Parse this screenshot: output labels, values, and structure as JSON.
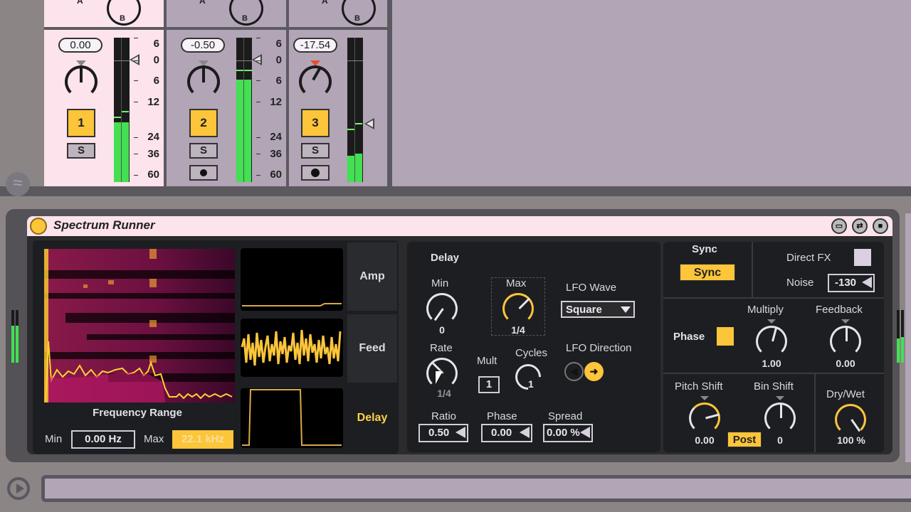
{
  "colors": {
    "accent": "#fcc53a",
    "meter_green": "#42e052",
    "title_bar": "#fde3ec",
    "device_bg": "#1d1e21",
    "mixer_bg": "#b2a5b6"
  },
  "mixer": {
    "crossfader": {
      "a_label": "A",
      "b_label": "B"
    },
    "meter_scale": [
      "6",
      "0",
      "6",
      "12",
      "24",
      "36",
      "60"
    ],
    "tracks": [
      {
        "number": "1",
        "volume": "0.00",
        "solo_label": "S",
        "arm_icon": "",
        "selected": true,
        "meter_level_left": 0.4,
        "meter_level_right": 0.42
      },
      {
        "number": "2",
        "volume": "-0.50",
        "solo_label": "S",
        "arm_icon": "metronome-icon",
        "selected": false,
        "meter_level_right": 0.71
      },
      {
        "number": "3",
        "volume": "-17.54",
        "solo_label": "S",
        "arm_icon": "record-icon",
        "selected": false,
        "meter_level_left": 0.18,
        "meter_level_right": 0.19
      }
    ]
  },
  "device": {
    "title": "Spectrum Runner",
    "title_icons": [
      "hot-swap-icon",
      "map-icon",
      "save-preset-icon"
    ],
    "frequency_range": {
      "label": "Frequency Range",
      "min_label": "Min",
      "min_value": "0.00 Hz",
      "max_label": "Max",
      "max_value": "22.1 kHz"
    },
    "tabs": [
      {
        "label": "Amp",
        "active": false
      },
      {
        "label": "Feed",
        "active": false
      },
      {
        "label": "Delay",
        "active": true
      }
    ],
    "delay": {
      "section_title": "Delay",
      "min": {
        "label": "Min",
        "value": "0"
      },
      "max": {
        "label": "Max",
        "value": "1/4"
      },
      "lfo_wave": {
        "label": "LFO Wave",
        "selected": "Square"
      },
      "rate": {
        "label": "Rate",
        "value": "1/4"
      },
      "mult": {
        "label": "Mult",
        "value": "1"
      },
      "cycles": {
        "label": "Cycles",
        "value": "1"
      },
      "lfo_direction": {
        "label": "LFO Direction",
        "selected": "right"
      },
      "ratio": {
        "label": "Ratio",
        "value": "0.50"
      },
      "phase": {
        "label": "Phase",
        "value": "0.00"
      },
      "spread": {
        "label": "Spread",
        "value": "0.00 %"
      }
    },
    "sync": {
      "label": "Sync",
      "button": "Sync"
    },
    "direct_fx": {
      "label": "Direct FX",
      "checked": false
    },
    "noise": {
      "label": "Noise",
      "value": "-130"
    },
    "phase_toggle": {
      "label": "Phase",
      "checked": true
    },
    "multiply": {
      "label": "Multiply",
      "value": "1.00"
    },
    "feedback": {
      "label": "Feedback",
      "value": "0.00"
    },
    "pitch_shift": {
      "label": "Pitch Shift",
      "value": "0.00"
    },
    "post_button": "Post",
    "bin_shift": {
      "label": "Bin Shift",
      "value": "0"
    },
    "dry_wet": {
      "label": "Dry/Wet",
      "value": "100 %"
    }
  }
}
